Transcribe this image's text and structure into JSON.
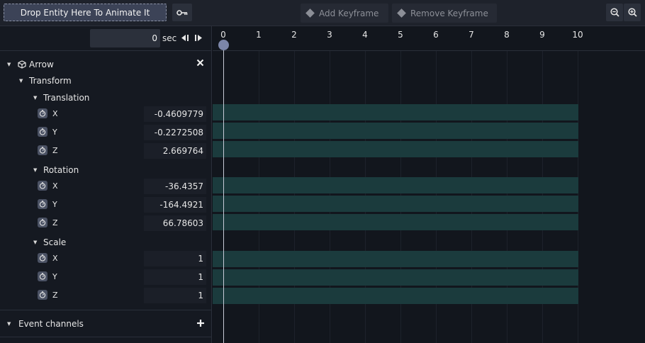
{
  "toolbar": {
    "drop_label": "Drop Entity Here To Animate It",
    "add_keyframe_label": "Add Keyframe",
    "remove_keyframe_label": "Remove Keyframe"
  },
  "time": {
    "value": "0",
    "unit": "sec"
  },
  "timeline": {
    "ticks": [
      "0",
      "1",
      "2",
      "3",
      "4",
      "5",
      "6",
      "7",
      "8",
      "9",
      "10"
    ]
  },
  "entity": {
    "name": "Arrow",
    "component": "Transform",
    "groups": [
      {
        "name": "Translation",
        "axes": [
          {
            "label": "X",
            "value": "-0.4609779"
          },
          {
            "label": "Y",
            "value": "-0.2272508"
          },
          {
            "label": "Z",
            "value": "2.669764"
          }
        ]
      },
      {
        "name": "Rotation",
        "axes": [
          {
            "label": "X",
            "value": "-36.4357"
          },
          {
            "label": "Y",
            "value": "-164.4921"
          },
          {
            "label": "Z",
            "value": "66.78603"
          }
        ]
      },
      {
        "name": "Scale",
        "axes": [
          {
            "label": "X",
            "value": "1"
          },
          {
            "label": "Y",
            "value": "1"
          },
          {
            "label": "Z",
            "value": "1"
          }
        ]
      }
    ]
  },
  "event_channels_label": "Event channels",
  "colors": {
    "track": "#1b3b3d",
    "playhead": "#7c86a9",
    "drop_button": "#3c4357"
  }
}
